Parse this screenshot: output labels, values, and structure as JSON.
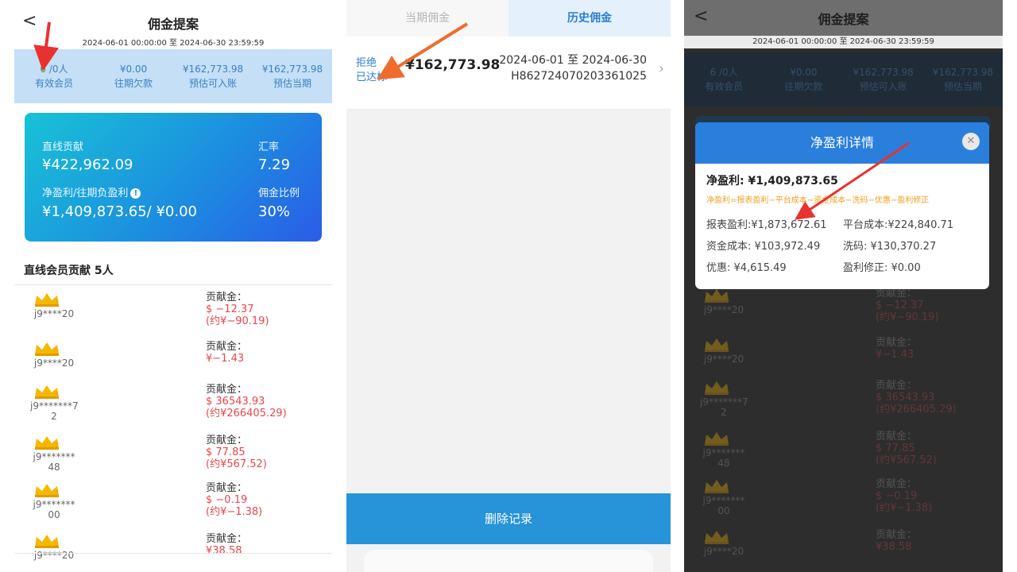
{
  "panel1": {
    "back_glyph": "<",
    "title": "佣金提案",
    "period": "2024-06-01 00:00:00 至 2024-06-30 23:59:59",
    "stats": [
      {
        "value_green": "6",
        "value_rest": " /0人",
        "label": "有效会员"
      },
      {
        "value": "¥0.00",
        "label": "往期欠款"
      },
      {
        "value": "¥162,773.98",
        "label": "预估可入账"
      },
      {
        "value": "¥162,773.98",
        "label": "预估当期"
      }
    ],
    "card": {
      "contrib_label": "直线贡献",
      "contrib_value": "¥422,962.09",
      "rate_label": "汇率",
      "rate_value": "7.29",
      "profit_label": "净盈利/往期负盈利",
      "profit_value": "¥1,409,873.65/ ¥0.00",
      "ratio_label": "佣金比例",
      "ratio_value": "30%",
      "info_glyph": "!"
    },
    "section_title": "直线会员贡献  5人",
    "contrib_key": "贡献金：",
    "members": [
      {
        "level": "3",
        "name_lines": [
          "j9****20"
        ],
        "usd": "$ −12.37",
        "cny": "(约¥−90.19)"
      },
      {
        "level": "3",
        "name_lines": [
          "j9****20"
        ],
        "usd": "¥−1.43",
        "cny": ""
      },
      {
        "level": "6",
        "name_lines": [
          "j9*******7",
          "2"
        ],
        "usd": "$ 36543.93",
        "cny": "(约¥266405.29)"
      },
      {
        "level": "2",
        "name_lines": [
          "j9*******",
          "48"
        ],
        "usd": "$ 77.85",
        "cny": "(约¥567.52)"
      },
      {
        "level": "4",
        "name_lines": [
          "j9*******",
          "00"
        ],
        "usd": "$ −0.19",
        "cny": "(约¥−1.38)"
      },
      {
        "level": "2",
        "name_lines": [
          "j9****20"
        ],
        "usd": "¥38.58",
        "cny": ""
      }
    ]
  },
  "panel2": {
    "tabs": [
      {
        "label": "当期佣金",
        "active": false
      },
      {
        "label": "历史佣金",
        "active": true
      }
    ],
    "row": {
      "status1": "拒绝",
      "status2": "已达标",
      "amount": "¥162,773.98",
      "date_range": "2024-06-01 至 2024-06-30",
      "id": "H862724070203361025",
      "chevron": "›"
    },
    "delete_button": "删除记录"
  },
  "panel3": {
    "back_glyph": "<",
    "title": "佣金提案",
    "period": "2024-06-01 00:00:00 至 2024-06-30 23:59:59",
    "stats": [
      {
        "value": "6 /0人",
        "label": "有效会员"
      },
      {
        "value": "¥0.00",
        "label": "往期欠款"
      },
      {
        "value": "¥162,773.98",
        "label": "预估可入账"
      },
      {
        "value": "¥162,773.98",
        "label": "预估当期"
      }
    ],
    "modal": {
      "title": "净盈利详情",
      "close_glyph": "✕",
      "net_profit": "净盈利: ¥1,409,873.65",
      "formula": "净盈利=报表盈利−平台成本−资金成本−洗码−优惠−盈利修正",
      "report_profit": "报表盈利:¥1,873,672.61",
      "platform_cost": "平台成本:¥224,840.71",
      "capital_cost": "资金成本: ¥103,972.49",
      "rebate": "洗码: ¥130,370.27",
      "discount": "优惠: ¥4,615.49",
      "profit_fix": "盈利修正: ¥0.00"
    },
    "contrib_key": "贡献金：",
    "members": [
      {
        "level": "3",
        "name_lines": [
          "j9****20"
        ],
        "usd": "$ −12.37",
        "cny": "(约¥−90.19)"
      },
      {
        "level": "3",
        "name_lines": [
          "j9****20"
        ],
        "usd": "¥−1.43",
        "cny": ""
      },
      {
        "level": "6",
        "name_lines": [
          "j9*******7",
          "2"
        ],
        "usd": "$ 36543.93",
        "cny": "(约¥266405.29)"
      },
      {
        "level": "2",
        "name_lines": [
          "j9*******",
          "48"
        ],
        "usd": "$ 77.85",
        "cny": "(约¥567.52)"
      },
      {
        "level": "4",
        "name_lines": [
          "j9*******",
          "00"
        ],
        "usd": "$ −0.19",
        "cny": "(约¥−1.38)"
      },
      {
        "level": "2",
        "name_lines": [
          "j9****20"
        ],
        "usd": "¥38.58",
        "cny": ""
      }
    ]
  },
  "colors": {
    "accent_blue": "#2c7fd0",
    "button_blue": "#2793d8",
    "negative_red": "#e8464a",
    "annotation_red": "#e8322f",
    "annotation_orange": "#ef6c2f",
    "formula_orange": "#f0a020",
    "crown_gold": "#f5b800"
  }
}
